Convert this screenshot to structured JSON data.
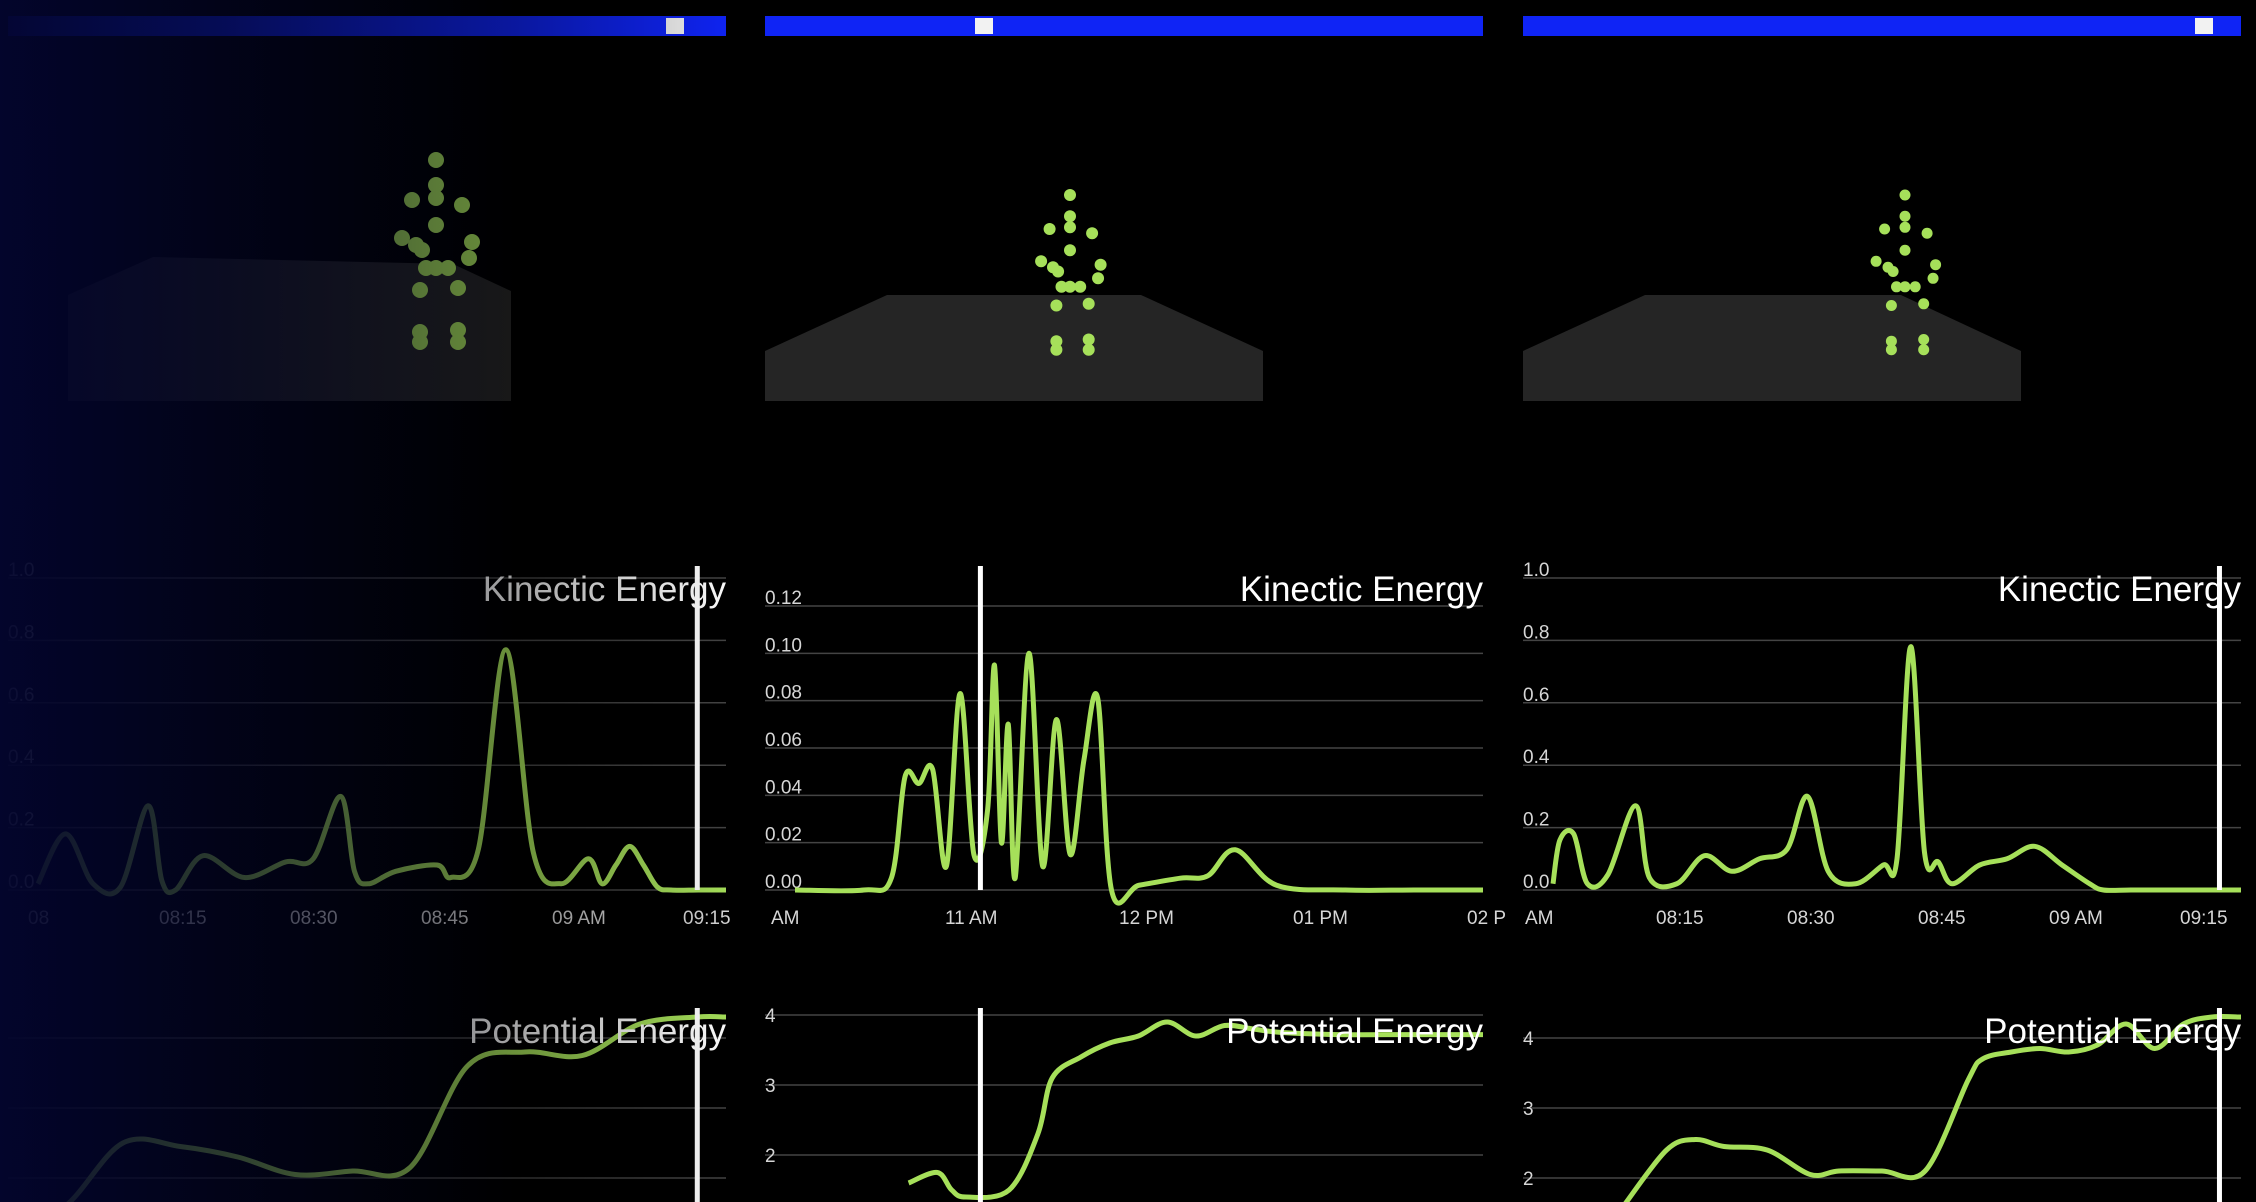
{
  "colors": {
    "accent": "#a6e05a",
    "timebar": "#0f24f5",
    "floor": "#252525",
    "grid": "#444444",
    "cursor": "#ffffff"
  },
  "panels": [
    {
      "timebar_position": 0.94,
      "ke": {
        "title": "Kinectic Energy",
        "xlabels": [
          "08",
          "08:15",
          "08:30",
          "08:45",
          "09 AM",
          "09:15"
        ],
        "ylabels": [
          "0.0",
          "0.2",
          "0.4",
          "0.6",
          "0.8",
          "1.0"
        ],
        "cursor_frac": 0.96
      },
      "pe": {
        "title": "Potential Energy",
        "ylabels": [
          "",
          "",
          ""
        ],
        "cursor_frac": 0.96
      }
    },
    {
      "timebar_position": 0.3,
      "ke": {
        "title": "Kinectic Energy",
        "xlabels": [
          "AM",
          "11 AM",
          "12 PM",
          "01 PM",
          "02 P"
        ],
        "ylabels": [
          "0.00",
          "0.02",
          "0.04",
          "0.06",
          "0.08",
          "0.10",
          "0.12"
        ],
        "cursor_frac": 0.3
      },
      "pe": {
        "title": "Potential Energy",
        "ylabels": [
          "4",
          "3",
          "2"
        ],
        "cursor_frac": 0.3
      }
    },
    {
      "timebar_position": 0.96,
      "ke": {
        "title": "Kinectic Energy",
        "xlabels": [
          "AM",
          "08:15",
          "08:30",
          "08:45",
          "09 AM",
          "09:15"
        ],
        "ylabels": [
          "0.0",
          "0.2",
          "0.4",
          "0.6",
          "0.8",
          "1.0"
        ],
        "cursor_frac": 0.97
      },
      "pe": {
        "title": "Potential Energy",
        "ylabels": [
          "4",
          "3",
          "2"
        ],
        "cursor_frac": 0.97
      }
    }
  ],
  "chart_data": [
    {
      "type": "line",
      "title": "Kinectic Energy",
      "categories": [
        "08",
        "08:15",
        "08:30",
        "08:45",
        "09 AM",
        "09:15"
      ],
      "ylim": [
        0,
        1.0
      ],
      "x": [
        0,
        4,
        8,
        12,
        16,
        18,
        20,
        24,
        30,
        36,
        40,
        44,
        46,
        48,
        52,
        58,
        60,
        64,
        68,
        72,
        76,
        80,
        82,
        84,
        86,
        88,
        90,
        92,
        96,
        100
      ],
      "values": [
        0.02,
        0.18,
        0.02,
        0.01,
        0.27,
        0.03,
        0.0,
        0.11,
        0.04,
        0.09,
        0.1,
        0.3,
        0.06,
        0.02,
        0.06,
        0.08,
        0.04,
        0.13,
        0.77,
        0.12,
        0.02,
        0.1,
        0.02,
        0.08,
        0.14,
        0.08,
        0.01,
        0.0,
        0.0,
        0.0
      ]
    },
    {
      "type": "line",
      "title": "Potential Energy",
      "ylim": [
        1.5,
        4.5
      ],
      "x": [
        0,
        8,
        16,
        24,
        32,
        40,
        48,
        56,
        64,
        72,
        80,
        88,
        96,
        100
      ],
      "values": [
        1.2,
        1.6,
        2.5,
        2.45,
        2.3,
        2.05,
        2.1,
        2.15,
        3.6,
        3.8,
        3.75,
        4.2,
        4.3,
        4.3
      ]
    },
    {
      "type": "line",
      "title": "Kinectic Energy",
      "categories": [
        "AM",
        "11 AM",
        "12 PM",
        "01 PM",
        "02 P"
      ],
      "ylim": [
        0,
        0.13
      ],
      "x": [
        0,
        10,
        14,
        16,
        18,
        20,
        22,
        24,
        26,
        28,
        29,
        30,
        31,
        32,
        34,
        36,
        38,
        40,
        42,
        44,
        46,
        50,
        56,
        60,
        64,
        70,
        80,
        90,
        100
      ],
      "values": [
        0.0,
        0.0,
        0.005,
        0.048,
        0.045,
        0.051,
        0.01,
        0.083,
        0.015,
        0.034,
        0.095,
        0.02,
        0.07,
        0.005,
        0.1,
        0.01,
        0.072,
        0.015,
        0.055,
        0.081,
        0.0,
        0.002,
        0.005,
        0.006,
        0.017,
        0.002,
        0.0,
        0.0,
        0.0
      ]
    },
    {
      "type": "line",
      "title": "Potential Energy",
      "ylim": [
        1.5,
        4.5
      ],
      "x": [
        20,
        24,
        26,
        28,
        34,
        38,
        40,
        44,
        48,
        52,
        56,
        60,
        64,
        68,
        72,
        80,
        90,
        100
      ],
      "values": [
        1.6,
        1.75,
        1.5,
        1.4,
        1.5,
        2.3,
        3.1,
        3.4,
        3.6,
        3.7,
        3.9,
        3.7,
        3.85,
        3.8,
        3.75,
        3.72,
        3.72,
        3.72
      ]
    },
    {
      "type": "line",
      "title": "Kinectic Energy",
      "categories": [
        "AM",
        "08:15",
        "08:30",
        "08:45",
        "09 AM",
        "09:15"
      ],
      "ylim": [
        0,
        1.0
      ],
      "x": [
        0,
        1,
        3,
        5,
        8,
        12,
        14,
        18,
        22,
        26,
        30,
        34,
        37,
        40,
        44,
        48,
        50,
        52,
        54,
        56,
        58,
        62,
        66,
        70,
        74,
        78,
        80,
        84,
        90,
        100
      ],
      "values": [
        0.02,
        0.16,
        0.18,
        0.02,
        0.05,
        0.27,
        0.04,
        0.02,
        0.11,
        0.06,
        0.1,
        0.13,
        0.3,
        0.06,
        0.02,
        0.08,
        0.1,
        0.78,
        0.12,
        0.09,
        0.02,
        0.08,
        0.1,
        0.14,
        0.08,
        0.02,
        0.0,
        0.0,
        0.0,
        0.0
      ]
    },
    {
      "type": "line",
      "title": "Potential Energy",
      "ylim": [
        1.5,
        4.5
      ],
      "x": [
        14,
        20,
        24,
        28,
        34,
        40,
        44,
        50,
        56,
        62,
        64,
        68,
        72,
        76,
        80,
        84,
        88,
        92,
        96,
        100
      ],
      "values": [
        1.6,
        2.4,
        2.55,
        2.45,
        2.4,
        2.05,
        2.1,
        2.1,
        2.1,
        3.4,
        3.7,
        3.8,
        3.85,
        3.8,
        3.9,
        4.2,
        3.85,
        4.2,
        4.3,
        4.3
      ]
    }
  ]
}
